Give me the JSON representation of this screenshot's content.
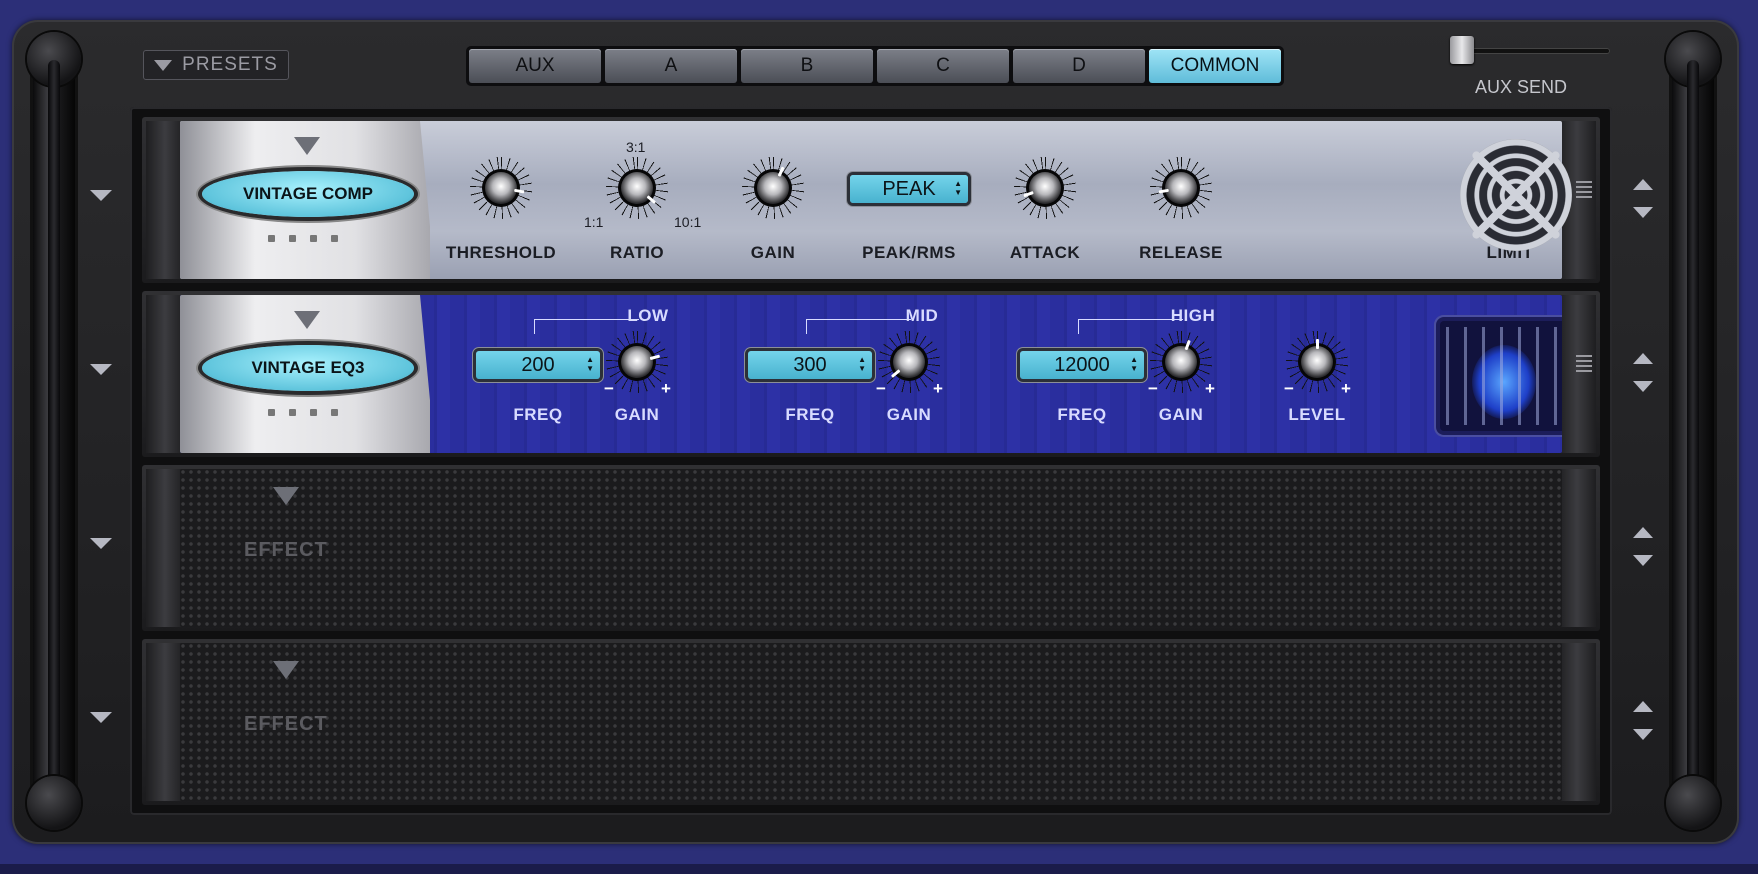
{
  "header": {
    "presets_label": "PRESETS",
    "tabs": [
      "AUX",
      "A",
      "B",
      "C",
      "D",
      "COMMON"
    ],
    "active_tab": "COMMON",
    "aux_send_label": "AUX SEND",
    "aux_send_level": 0.0
  },
  "slots": [
    {
      "name": "VINTAGE COMP",
      "controls": {
        "threshold": "THRESHOLD",
        "ratio": "RATIO",
        "ratio_min": "1:1",
        "ratio_mid": "3:1",
        "ratio_max": "10:1",
        "gain": "GAIN",
        "peak_rms": "PEAK/RMS",
        "peak_rms_value": "PEAK",
        "attack": "ATTACK",
        "release": "RELEASE",
        "limit": "LIMIT"
      }
    },
    {
      "name": "VINTAGE EQ3",
      "bands": {
        "low": "LOW",
        "mid": "MID",
        "high": "HIGH"
      },
      "controls": {
        "low_freq": "200",
        "mid_freq": "300",
        "high_freq": "12000",
        "freq": "FREQ",
        "gain": "GAIN",
        "level": "LEVEL",
        "minus": "−",
        "plus": "+"
      }
    },
    {
      "name": "EFFECT"
    },
    {
      "name": "EFFECT"
    }
  ],
  "colors": {
    "accent": "#5fbcd9",
    "background": "#2c2f78",
    "led": "#f0a12a"
  }
}
